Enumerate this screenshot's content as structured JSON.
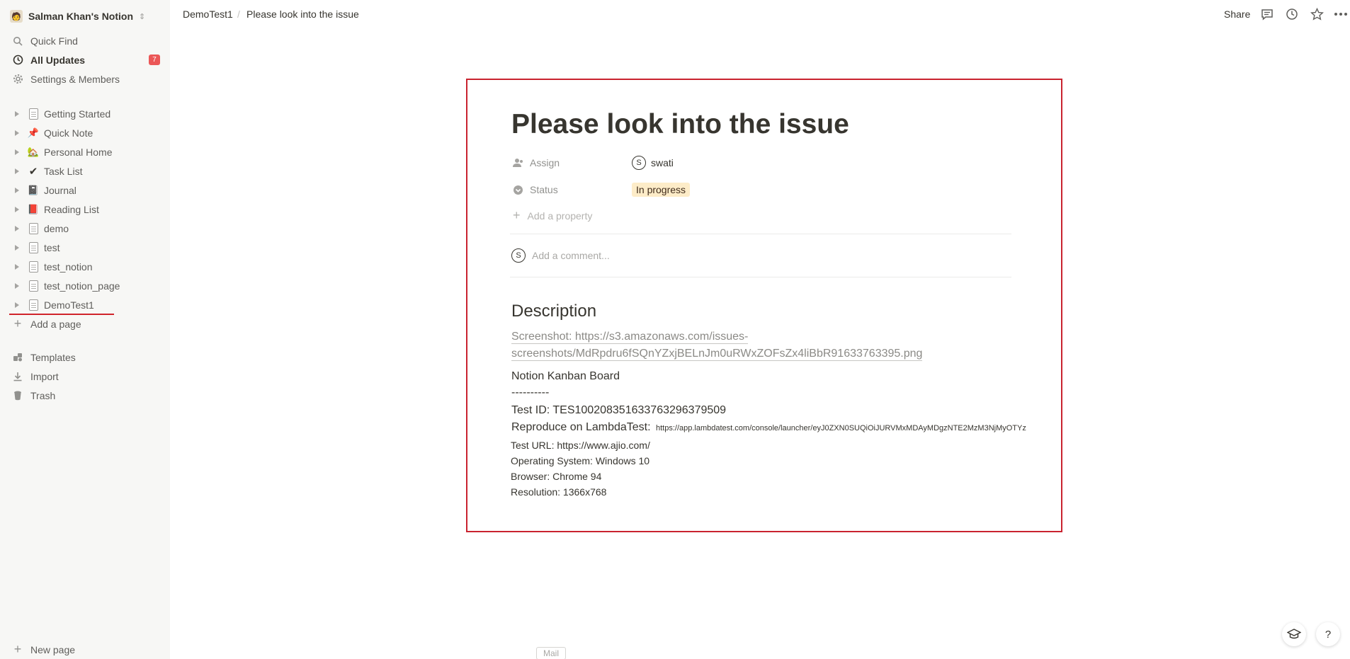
{
  "sidebar": {
    "workspace": {
      "name": "Salman Khan's Notion",
      "avatar": "person-avatar",
      "chevron": "⌃"
    },
    "nav": [
      {
        "label": "Quick Find",
        "icon": "search-icon"
      },
      {
        "label": "All Updates",
        "icon": "clock-icon",
        "badge": "7"
      },
      {
        "label": "Settings & Members",
        "icon": "gear-icon"
      }
    ],
    "pages": [
      {
        "label": "Getting Started",
        "icon": "page-icon"
      },
      {
        "label": "Quick Note",
        "icon": "pushpin-icon"
      },
      {
        "label": "Personal Home",
        "icon": "house-icon"
      },
      {
        "label": "Task List",
        "icon": "checkmark-icon"
      },
      {
        "label": "Journal",
        "icon": "notebook-icon"
      },
      {
        "label": "Reading List",
        "icon": "red-book-icon"
      },
      {
        "label": "demo",
        "icon": "page-icon"
      },
      {
        "label": "test",
        "icon": "page-icon"
      },
      {
        "label": "test_notion",
        "icon": "page-icon"
      },
      {
        "label": "test_notion_page",
        "icon": "page-icon"
      },
      {
        "label": "DemoTest1",
        "icon": "page-icon"
      }
    ],
    "add_page": "Add a page",
    "footer": [
      {
        "label": "Templates",
        "icon": "templates-icon"
      },
      {
        "label": "Import",
        "icon": "download-icon"
      },
      {
        "label": "Trash",
        "icon": "trash-icon"
      }
    ],
    "new_page": "New page"
  },
  "topbar": {
    "breadcrumb": [
      "DemoTest1",
      "Please look into the issue"
    ],
    "separator": "/",
    "share": "Share"
  },
  "page": {
    "title": "Please look into the issue",
    "properties": [
      {
        "label": "Assign",
        "value": "swati",
        "avatar": "S"
      },
      {
        "label": "Status",
        "value": "In progress"
      }
    ],
    "add_property": "Add a property",
    "comment_avatar": "S",
    "comment_placeholder": "Add a comment...",
    "description_heading": "Description",
    "screenshot_line1": "Screenshot: https://s3.amazonaws.com/issues-",
    "screenshot_line2": "screenshots/MdRpdru6fSQnYZxjBELnJm0uRWxZOFsZx4liBbR91633763395.png",
    "board_title": "Notion Kanban Board",
    "dashes": "----------",
    "test_id": "Test ID: TES100208351633763296379509",
    "reproduce_label": "Reproduce on LambdaTest:",
    "reproduce_url": "https://app.lambdatest.com/console/launcher/eyJ0ZXN0SUQiOiJURVMxMDAyMDgzNTE2MzM3NjMyOTYz",
    "test_url": "Test URL: https://www.ajio.com/",
    "os": "Operating System: Windows 10",
    "browser": "Browser: Chrome 94",
    "resolution": "Resolution: 1366x768"
  },
  "tooltip": {
    "mail": "Mail"
  },
  "floating": {
    "help": "?"
  },
  "colors": {
    "accent_red": "#c9232f",
    "status_bg": "#fdecc8",
    "badge_red": "#eb5757"
  }
}
